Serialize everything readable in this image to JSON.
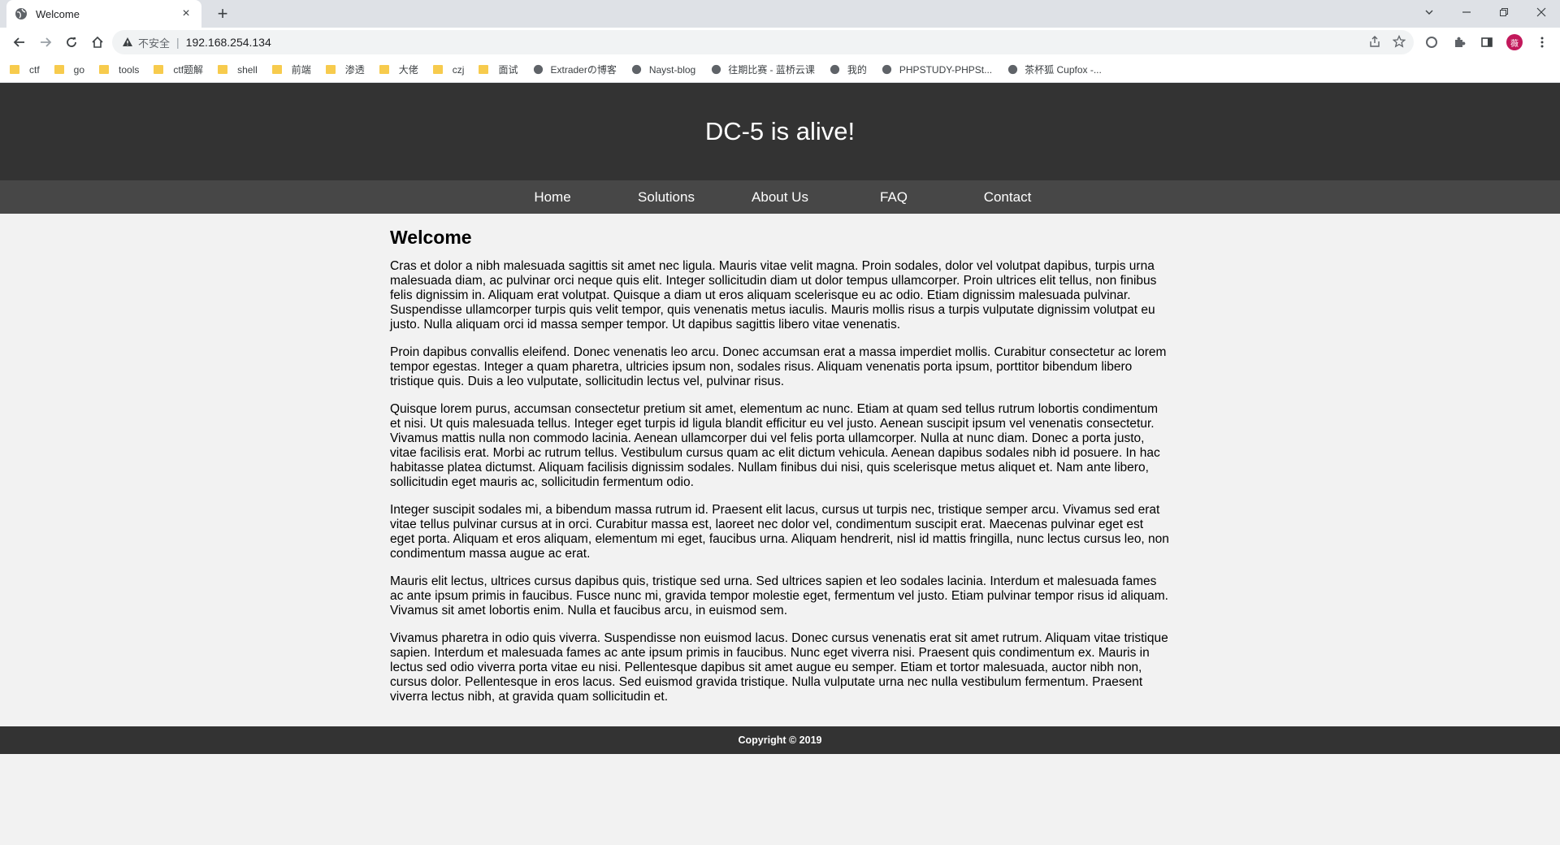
{
  "browser": {
    "tab_title": "Welcome",
    "tab_close": "×",
    "new_tab": "+",
    "security_label": "不安全",
    "url": "192.168.254.134",
    "bookmarks": [
      {
        "label": "ctf",
        "icon": "folder-icon"
      },
      {
        "label": "go",
        "icon": "folder-icon"
      },
      {
        "label": "tools",
        "icon": "folder-icon"
      },
      {
        "label": "ctf题解",
        "icon": "folder-icon"
      },
      {
        "label": "shell",
        "icon": "folder-icon"
      },
      {
        "label": "前端",
        "icon": "folder-icon"
      },
      {
        "label": "渗透",
        "icon": "folder-icon"
      },
      {
        "label": "大佬",
        "icon": "folder-icon"
      },
      {
        "label": "czj",
        "icon": "folder-icon"
      },
      {
        "label": "面试",
        "icon": "folder-icon"
      },
      {
        "label": "Extraderの博客",
        "icon": "site-icon"
      },
      {
        "label": "Nayst-blog",
        "icon": "site-icon"
      },
      {
        "label": "往期比赛 - 蓝桥云课",
        "icon": "site-icon"
      },
      {
        "label": "我的",
        "icon": "globe-icon"
      },
      {
        "label": "PHPSTUDY-PHPSt...",
        "icon": "site-icon"
      },
      {
        "label": "茶杯狐 Cupfox -...",
        "icon": "site-icon"
      }
    ],
    "avatar_letter": "薇"
  },
  "site": {
    "title": "DC-5 is alive!",
    "nav": [
      "Home",
      "Solutions",
      "About Us",
      "FAQ",
      "Contact"
    ],
    "heading": "Welcome",
    "paragraphs": [
      "Cras et dolor a nibh malesuada sagittis sit amet nec ligula. Mauris vitae velit magna. Proin sodales, dolor vel volutpat dapibus, turpis urna malesuada diam, ac pulvinar orci neque quis elit. Integer sollicitudin diam ut dolor tempus ullamcorper. Proin ultrices elit tellus, non finibus felis dignissim in. Aliquam erat volutpat. Quisque a diam ut eros aliquam scelerisque eu ac odio. Etiam dignissim malesuada pulvinar. Suspendisse ullamcorper turpis quis velit tempor, quis venenatis metus iaculis. Mauris mollis risus a turpis vulputate dignissim volutpat eu justo. Nulla aliquam orci id massa semper tempor. Ut dapibus sagittis libero vitae venenatis.",
      "Proin dapibus convallis eleifend. Donec venenatis leo arcu. Donec accumsan erat a massa imperdiet mollis. Curabitur consectetur ac lorem tempor egestas. Integer a quam pharetra, ultricies ipsum non, sodales risus. Aliquam venenatis porta ipsum, porttitor bibendum libero tristique quis. Duis a leo vulputate, sollicitudin lectus vel, pulvinar risus.",
      "Quisque lorem purus, accumsan consectetur pretium sit amet, elementum ac nunc. Etiam at quam sed tellus rutrum lobortis condimentum et nisi. Ut quis malesuada tellus. Integer eget turpis id ligula blandit efficitur eu vel justo. Aenean suscipit ipsum vel venenatis consectetur. Vivamus mattis nulla non commodo lacinia. Aenean ullamcorper dui vel felis porta ullamcorper. Nulla at nunc diam. Donec a porta justo, vitae facilisis erat. Morbi ac rutrum tellus. Vestibulum cursus quam ac elit dictum vehicula. Aenean dapibus sodales nibh id posuere. In hac habitasse platea dictumst. Aliquam facilisis dignissim sodales. Nullam finibus dui nisi, quis scelerisque metus aliquet et. Nam ante libero, sollicitudin eget mauris ac, sollicitudin fermentum odio.",
      "Integer suscipit sodales mi, a bibendum massa rutrum id. Praesent elit lacus, cursus ut turpis nec, tristique semper arcu. Vivamus sed erat vitae tellus pulvinar cursus at in orci. Curabitur massa est, laoreet nec dolor vel, condimentum suscipit erat. Maecenas pulvinar eget est eget porta. Aliquam et eros aliquam, elementum mi eget, faucibus urna. Aliquam hendrerit, nisl id mattis fringilla, nunc lectus cursus leo, non condimentum massa augue ac erat.",
      "Mauris elit lectus, ultrices cursus dapibus quis, tristique sed urna. Sed ultrices sapien et leo sodales lacinia. Interdum et malesuada fames ac ante ipsum primis in faucibus. Fusce nunc mi, gravida tempor molestie eget, fermentum vel justo. Etiam pulvinar tempor risus id aliquam. Vivamus sit amet lobortis enim. Nulla et faucibus arcu, in euismod sem.",
      "Vivamus pharetra in odio quis viverra. Suspendisse non euismod lacus. Donec cursus venenatis erat sit amet rutrum. Aliquam vitae tristique sapien. Interdum et malesuada fames ac ante ipsum primis in faucibus. Nunc eget viverra nisi. Praesent quis condimentum ex. Mauris in lectus sed odio viverra porta vitae eu nisi. Pellentesque dapibus sit amet augue eu semper. Etiam et tortor malesuada, auctor nibh non, cursus dolor. Pellentesque in eros lacus. Sed euismod gravida tristique. Nulla vulputate urna nec nulla vestibulum fermentum. Praesent viverra lectus nibh, at gravida quam sollicitudin et."
    ],
    "footer": "Copyright © 2019"
  },
  "colors": {
    "header_bg": "#333333",
    "nav_bg": "#474747",
    "page_bg": "#f2f2f2",
    "folder": "#f7cb4d"
  }
}
